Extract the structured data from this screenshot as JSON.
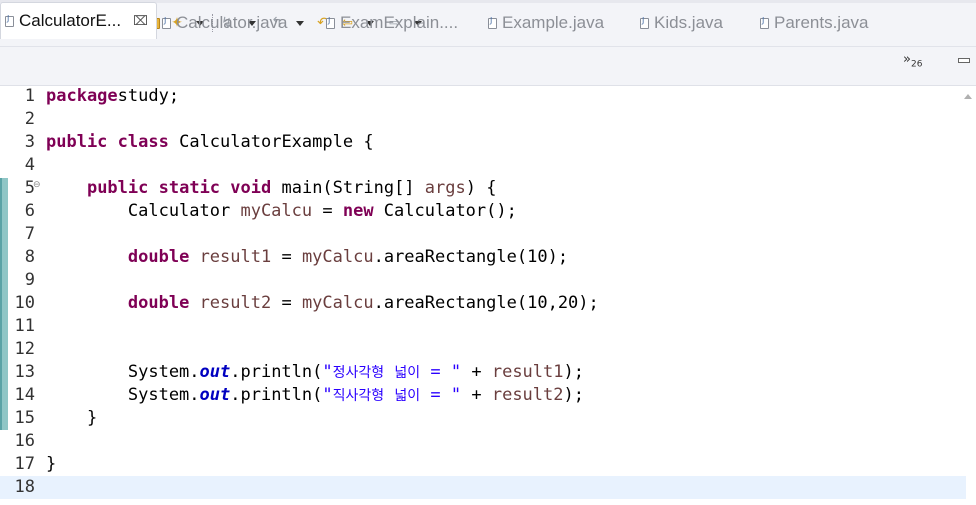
{
  "toolbar": {
    "icons": [
      "dropdown-icon",
      "run-icon",
      "dropdown-icon",
      "debug-icon",
      "dropdown-icon",
      "open-type-icon",
      "open-folder-icon",
      "wand-icon",
      "dropdown-icon",
      "next-annotation-icon",
      "dropdown-icon",
      "prev-annotation-icon",
      "dropdown-icon",
      "last-edit-icon",
      "back-icon",
      "dropdown-icon",
      "forward-icon",
      "dropdown-icon"
    ]
  },
  "tabs": [
    {
      "label": "CalculatorE...",
      "active": true,
      "close": "⌧"
    },
    {
      "label": "Calculator.java"
    },
    {
      "label": "ExamExplain...."
    },
    {
      "label": "Example.java"
    },
    {
      "label": "Kids.java"
    },
    {
      "label": "Parents.java"
    }
  ],
  "overflow": {
    "arrows": "»",
    "count": "26"
  },
  "editor": {
    "fold_marker": "⊖",
    "lines": [
      {
        "num": "1",
        "tokens": [
          [
            "kw",
            "package"
          ],
          [
            "",
            "study;"
          ]
        ]
      },
      {
        "num": "2",
        "tokens": []
      },
      {
        "num": "3",
        "tokens": [
          [
            "kw",
            "public"
          ],
          [
            "",
            " "
          ],
          [
            "kw",
            "class"
          ],
          [
            "",
            " CalculatorExample {"
          ]
        ]
      },
      {
        "num": "4",
        "tokens": []
      },
      {
        "num": "5",
        "tokens": [
          [
            "",
            "    "
          ],
          [
            "kw",
            "public"
          ],
          [
            "",
            " "
          ],
          [
            "kw",
            "static"
          ],
          [
            "",
            " "
          ],
          [
            "kw",
            "void"
          ],
          [
            "",
            " main(String[] "
          ],
          [
            "var",
            "args"
          ],
          [
            "",
            ") {"
          ]
        ]
      },
      {
        "num": "6",
        "tokens": [
          [
            "",
            "        Calculator "
          ],
          [
            "var",
            "myCalcu"
          ],
          [
            "",
            " = "
          ],
          [
            "kw",
            "new"
          ],
          [
            "",
            " Calculator();"
          ]
        ]
      },
      {
        "num": "7",
        "tokens": []
      },
      {
        "num": "8",
        "tokens": [
          [
            "",
            "        "
          ],
          [
            "kw",
            "double"
          ],
          [
            "",
            " "
          ],
          [
            "var",
            "result1"
          ],
          [
            "",
            " = "
          ],
          [
            "var",
            "myCalcu"
          ],
          [
            "",
            ".areaRectangle(10);"
          ]
        ]
      },
      {
        "num": "9",
        "tokens": []
      },
      {
        "num": "10",
        "tokens": [
          [
            "",
            "        "
          ],
          [
            "kw",
            "double"
          ],
          [
            "",
            " "
          ],
          [
            "var",
            "result2"
          ],
          [
            "",
            " = "
          ],
          [
            "var",
            "myCalcu"
          ],
          [
            "",
            ".areaRectangle(10,20);"
          ]
        ]
      },
      {
        "num": "11",
        "tokens": []
      },
      {
        "num": "12",
        "tokens": []
      },
      {
        "num": "13",
        "tokens": [
          [
            "",
            "        System."
          ],
          [
            "fld",
            "out"
          ],
          [
            "",
            ".println("
          ],
          [
            "str",
            "\"정사각형 넓이 = \""
          ],
          [
            "",
            " + "
          ],
          [
            "var",
            "result1"
          ],
          [
            "",
            ");"
          ]
        ]
      },
      {
        "num": "14",
        "tokens": [
          [
            "",
            "        System."
          ],
          [
            "fld",
            "out"
          ],
          [
            "",
            ".println("
          ],
          [
            "str",
            "\"직사각형 넓이 = \""
          ],
          [
            "",
            " + "
          ],
          [
            "var",
            "result2"
          ],
          [
            "",
            ");"
          ]
        ]
      },
      {
        "num": "15",
        "tokens": [
          [
            "",
            "    }"
          ]
        ]
      },
      {
        "num": "16",
        "tokens": []
      },
      {
        "num": "17",
        "tokens": [
          [
            "",
            "}"
          ]
        ]
      },
      {
        "num": "18",
        "tokens": []
      }
    ]
  }
}
